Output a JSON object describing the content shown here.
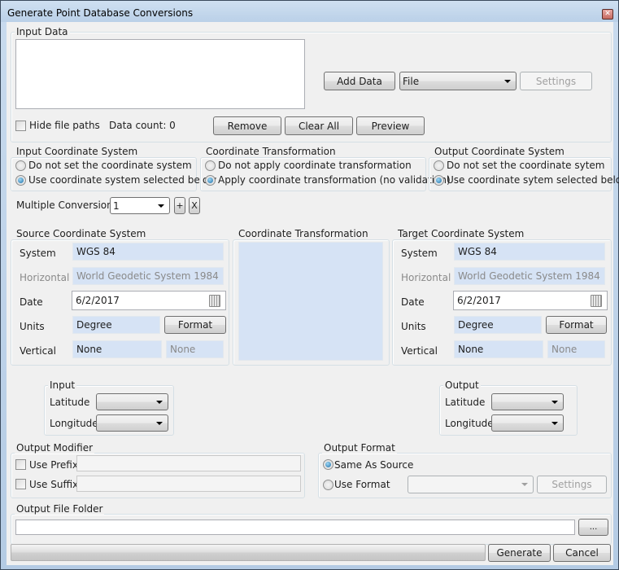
{
  "window": {
    "title": "Generate Point Database Conversions",
    "close_icon": "close-icon"
  },
  "input_data": {
    "group_label": "Input Data",
    "file_list_items": [],
    "add_data_label": "Add Data",
    "source_type_selected": "File",
    "settings_label": "Settings",
    "hide_file_paths_label": "Hide file paths",
    "hide_file_paths_checked": false,
    "data_count_label": "Data count: 0",
    "remove_label": "Remove",
    "clear_all_label": "Clear All",
    "preview_label": "Preview"
  },
  "input_cs": {
    "group_label": "Input Coordinate System",
    "options": [
      {
        "label": "Do not set the coordinate system",
        "selected": false
      },
      {
        "label": "Use coordinate system selected below",
        "selected": true
      }
    ]
  },
  "coord_transform_opts": {
    "group_label": "Coordinate Transformation",
    "options": [
      {
        "label": "Do not apply coordinate transformation",
        "selected": false
      },
      {
        "label": "Apply coordinate transformation (no validation)",
        "selected": true
      }
    ]
  },
  "output_cs": {
    "group_label": "Output Coordinate System",
    "options": [
      {
        "label": "Do not set the coordinate sytem",
        "selected": false
      },
      {
        "label": "Use coordinate sytem selected below",
        "selected": true
      }
    ]
  },
  "multiple_conversion": {
    "label": "Multiple Conversion",
    "selected": "1",
    "add_label": "+",
    "remove_label": "X"
  },
  "source_cs": {
    "group_label": "Source Coordinate System",
    "system_label": "System",
    "system_value": "WGS 84",
    "horizontal_label": "Horizontal",
    "horizontal_value": "World Geodetic System 1984",
    "date_label": "Date",
    "date_value": "6/2/2017",
    "units_label": "Units",
    "units_value": "Degree",
    "format_label": "Format",
    "vertical_label": "Vertical",
    "vertical_value": "None",
    "vertical_secondary": "None"
  },
  "transform_panel": {
    "group_label": "Coordinate Transformation"
  },
  "target_cs": {
    "group_label": "Target Coordinate System",
    "system_label": "System",
    "system_value": "WGS 84",
    "horizontal_label": "Horizontal",
    "horizontal_value": "World Geodetic System 1984",
    "date_label": "Date",
    "date_value": "6/2/2017",
    "units_label": "Units",
    "units_value": "Degree",
    "format_label": "Format",
    "vertical_label": "Vertical",
    "vertical_value": "None",
    "vertical_secondary": "None"
  },
  "input_fields": {
    "group_label": "Input",
    "latitude_label": "Latitude",
    "latitude_value": "",
    "longitude_label": "Longitude",
    "longitude_value": ""
  },
  "output_fields": {
    "group_label": "Output",
    "latitude_label": "Latitude",
    "latitude_value": "",
    "longitude_label": "Longitude",
    "longitude_value": ""
  },
  "output_modifier": {
    "group_label": "Output Modifier",
    "prefix_label": "Use Prefix",
    "prefix_checked": false,
    "prefix_value": "",
    "suffix_label": "Use Suffix",
    "suffix_checked": false,
    "suffix_value": ""
  },
  "output_format": {
    "group_label": "Output Format",
    "same_as_source_label": "Same As Source",
    "same_as_source_selected": true,
    "use_format_label": "Use Format",
    "use_format_selected": false,
    "format_selected": "",
    "settings_label": "Settings"
  },
  "output_folder": {
    "group_label": "Output File Folder",
    "path_value": "",
    "browse_label": "..."
  },
  "footer": {
    "progress_fraction": 0,
    "generate_label": "Generate",
    "cancel_label": "Cancel"
  }
}
